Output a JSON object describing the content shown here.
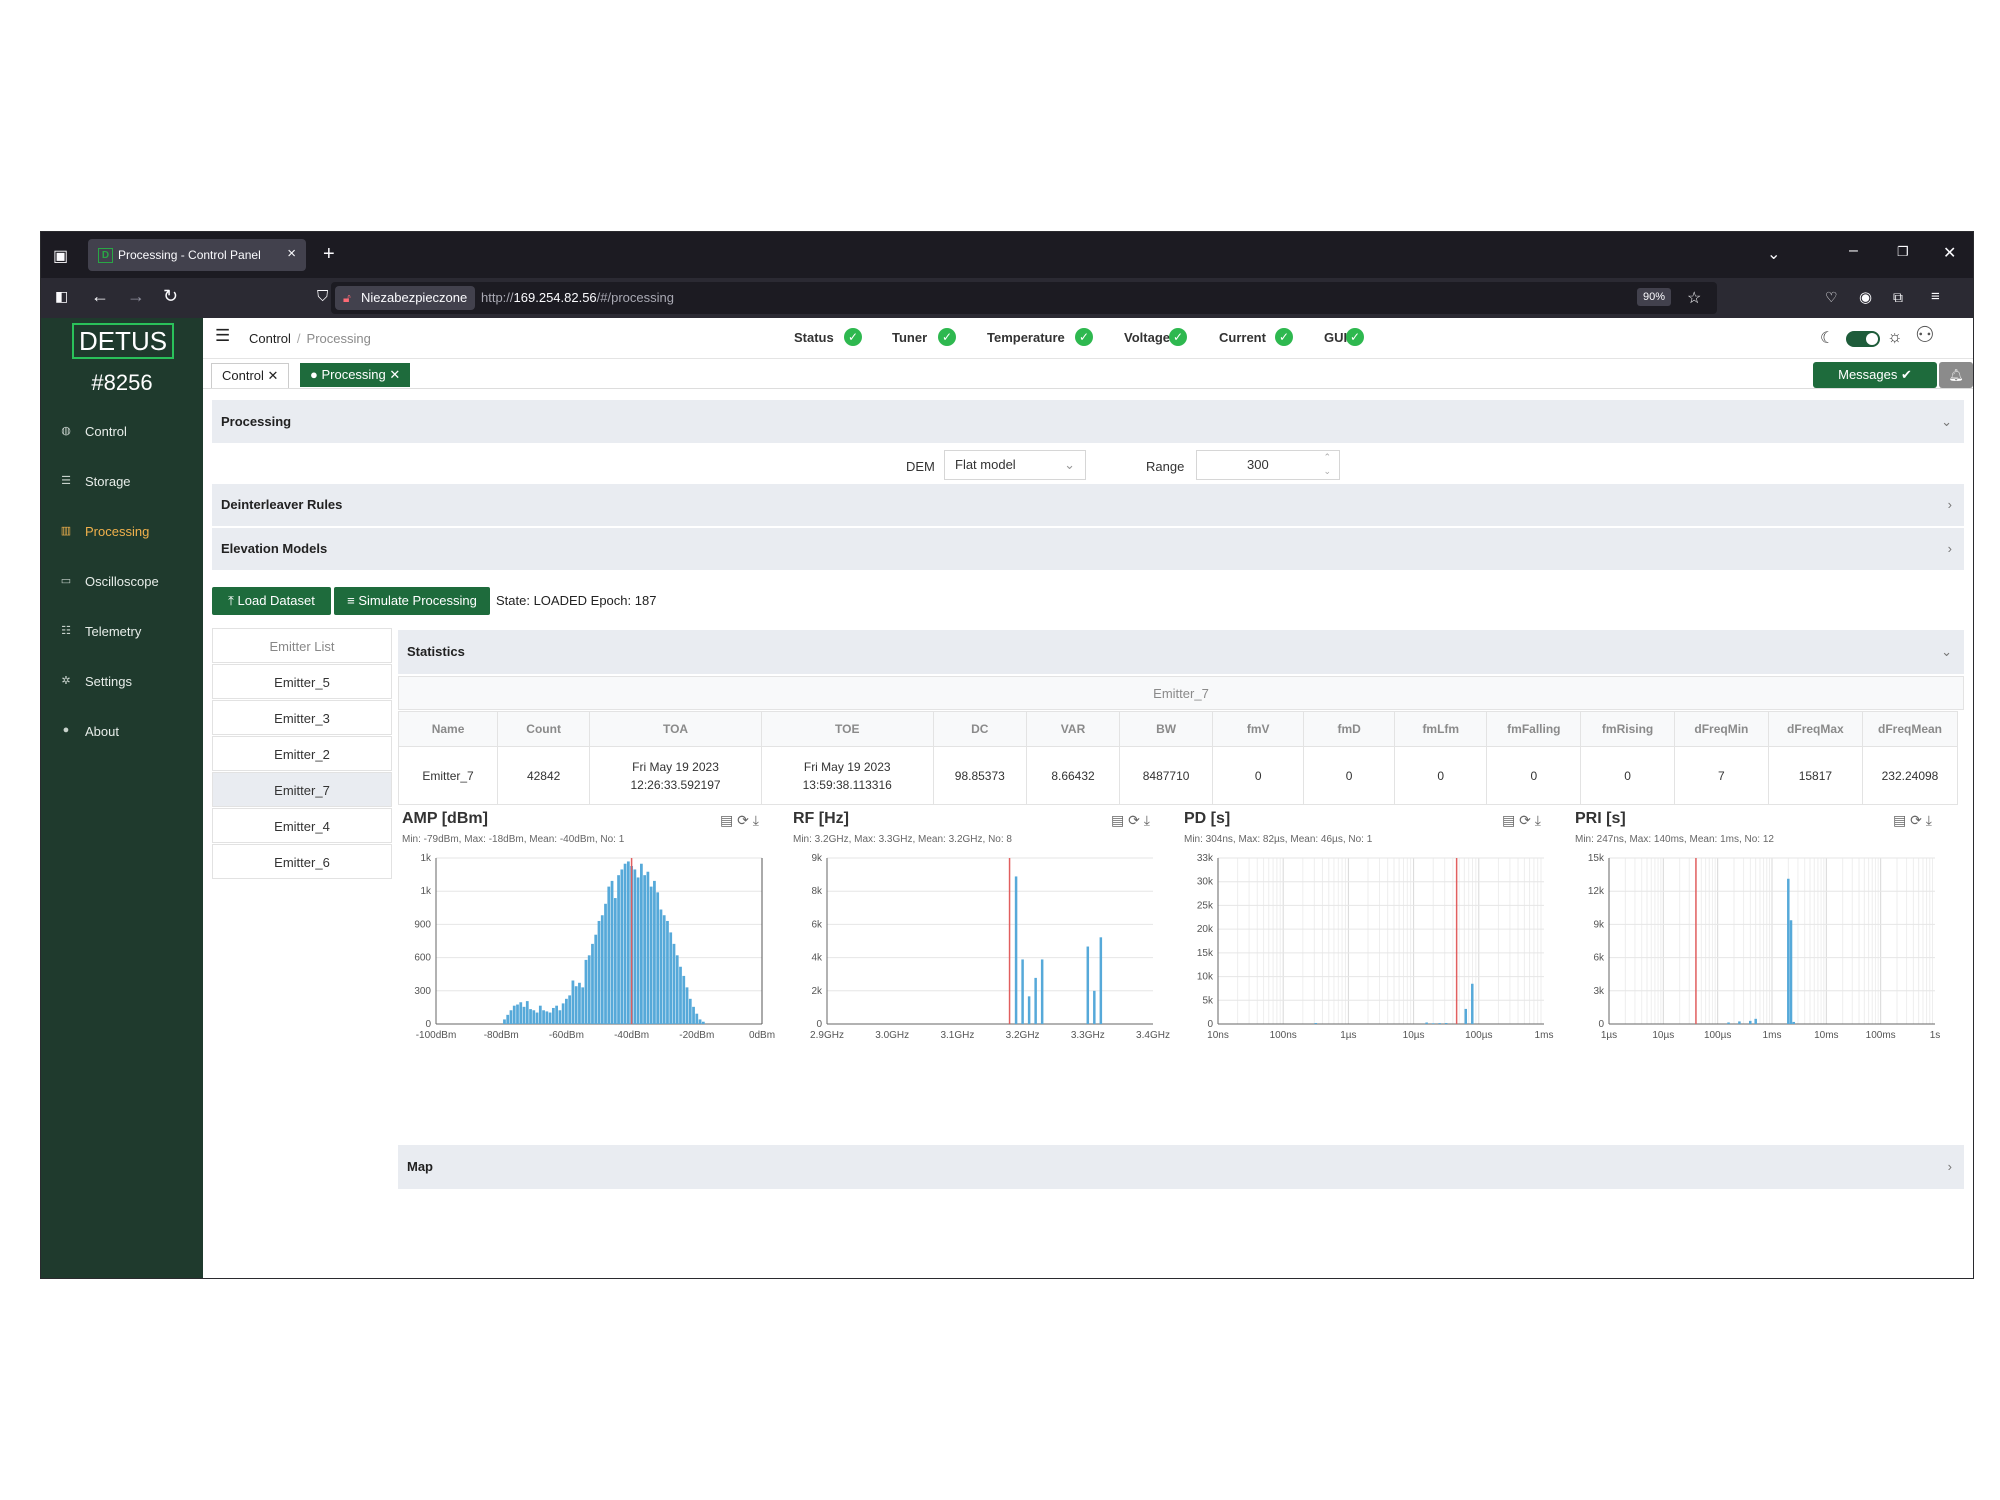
{
  "browser": {
    "tab_title": "Processing - Control Panel",
    "favicon_letter": "D",
    "insecure_label": "Niezabezpieczone",
    "url_prefix": "http://",
    "url_host": "169.254.82.56",
    "url_path": "/#/processing",
    "zoom": "90%"
  },
  "sidebar": {
    "brand": "DETUS",
    "device_id": "#8256",
    "items": [
      {
        "label": "Control",
        "icon": "dashboard-icon"
      },
      {
        "label": "Storage",
        "icon": "database-icon"
      },
      {
        "label": "Processing",
        "icon": "bar-chart-icon",
        "active": true
      },
      {
        "label": "Oscilloscope",
        "icon": "monitor-icon"
      },
      {
        "label": "Telemetry",
        "icon": "list-icon"
      },
      {
        "label": "Settings",
        "icon": "gear-icon"
      },
      {
        "label": "About",
        "icon": "info-icon"
      }
    ]
  },
  "header": {
    "breadcrumb": [
      "Control",
      "Processing"
    ],
    "statuses": [
      "Status",
      "Tuner",
      "Temperature",
      "Voltage",
      "Current",
      "GUI"
    ]
  },
  "page_tabs": {
    "control": "Control ✕",
    "processing": "● Processing ✕",
    "messages": "Messages"
  },
  "processing": {
    "title": "Processing",
    "dem_label": "DEM",
    "dem_value": "Flat model",
    "range_label": "Range",
    "range_value": "300",
    "deinterleaver": "Deinterleaver Rules",
    "elevation": "Elevation Models",
    "load_btn": "⤒ Load Dataset",
    "sim_btn": "≡ Simulate Processing",
    "state": "State: LOADED Epoch: 187"
  },
  "emitter_list": {
    "header": "Emitter List",
    "items": [
      "Emitter_5",
      "Emitter_3",
      "Emitter_2",
      "Emitter_7",
      "Emitter_4",
      "Emitter_6"
    ],
    "selected": "Emitter_7"
  },
  "statistics": {
    "title": "Statistics",
    "emitter": "Emitter_7",
    "columns": [
      "Name",
      "Count",
      "TOA",
      "TOE",
      "DC",
      "VAR",
      "BW",
      "fmV",
      "fmD",
      "fmLfm",
      "fmFalling",
      "fmRising",
      "dFreqMin",
      "dFreqMax",
      "dFreqMean"
    ],
    "row": [
      "Emitter_7",
      "42842",
      "Fri May 19 2023 12:26:33.592197",
      "Fri May 19 2023 13:59:38.113316",
      "98.85373",
      "8.66432",
      "8487710",
      "0",
      "0",
      "0",
      "0",
      "0",
      "7",
      "15817",
      "232.24098"
    ]
  },
  "map": {
    "title": "Map"
  },
  "chart_data": [
    {
      "type": "bar",
      "title": "AMP [dBm]",
      "subtitle": "Min: -79dBm, Max: -18dBm, Mean: -40dBm, No: 1",
      "x_tick_labels": [
        "-100dBm",
        "-80dBm",
        "-60dBm",
        "-40dBm",
        "-20dBm",
        "0dBm"
      ],
      "y_tick_labels": [
        "0",
        "300",
        "600",
        "900",
        "1k",
        "1k"
      ],
      "ylim": [
        0,
        1450
      ],
      "xlim": [
        -100,
        0
      ],
      "bins": [
        -79,
        -78,
        -77,
        -76,
        -75,
        -74,
        -73,
        -72,
        -71,
        -70,
        -69,
        -68,
        -67,
        -66,
        -65,
        -64,
        -63,
        -62,
        -61,
        -60,
        -59,
        -58,
        -57,
        -56,
        -55,
        -54,
        -53,
        -52,
        -51,
        -50,
        -49,
        -48,
        -47,
        -46,
        -45,
        -44,
        -43,
        -42,
        -41,
        -40,
        -39,
        -38,
        -37,
        -36,
        -35,
        -34,
        -33,
        -32,
        -31,
        -30,
        -29,
        -28,
        -27,
        -26,
        -25,
        -24,
        -23,
        -22,
        -21,
        -20,
        -19,
        -18
      ],
      "values": [
        40,
        80,
        120,
        160,
        170,
        190,
        150,
        200,
        130,
        120,
        100,
        160,
        120,
        110,
        100,
        140,
        160,
        120,
        180,
        220,
        250,
        380,
        330,
        360,
        320,
        560,
        600,
        700,
        780,
        900,
        950,
        1050,
        1200,
        1250,
        1100,
        1300,
        1350,
        1400,
        1420,
        1380,
        1350,
        1280,
        1400,
        1300,
        1330,
        1200,
        1250,
        1150,
        1000,
        950,
        900,
        800,
        700,
        600,
        500,
        420,
        320,
        220,
        150,
        90,
        40,
        20
      ],
      "mean": -40,
      "colors": {
        "bar": "#56a9d9",
        "mean": "#e15f5f"
      }
    },
    {
      "type": "bar",
      "title": "RF [Hz]",
      "subtitle": "Min: 3.2GHz, Max: 3.3GHz, Mean: 3.2GHz, No: 8",
      "x_tick_labels": [
        "2.9GHz",
        "3.0GHz",
        "3.1GHz",
        "3.2GHz",
        "3.3GHz",
        "3.4GHz"
      ],
      "y_tick_labels": [
        "0",
        "2k",
        "4k",
        "6k",
        "8k",
        "9k"
      ],
      "ylim": [
        0,
        9000
      ],
      "xlim": [
        2.9,
        3.4
      ],
      "bins": [
        3.19,
        3.2,
        3.21,
        3.22,
        3.23,
        3.3,
        3.31,
        3.32
      ],
      "values": [
        8000,
        3500,
        1500,
        2500,
        3500,
        4200,
        1800,
        4700
      ],
      "mean": 3.18,
      "colors": {
        "bar": "#56a9d9",
        "mean": "#e15f5f"
      }
    },
    {
      "type": "bar",
      "scale": "log",
      "title": "PD [s]",
      "subtitle": "Min: 304ns, Max: 82µs, Mean: 46µs, No: 1",
      "x_tick_labels": [
        "10ns",
        "100ns",
        "1µs",
        "10µs",
        "100µs",
        "1ms"
      ],
      "y_tick_labels": [
        "0",
        "5k",
        "10k",
        "15k",
        "20k",
        "25k",
        "30k",
        "33k"
      ],
      "ylim": [
        0,
        33000
      ],
      "xlim_log10": [
        -8,
        -3
      ],
      "bins_log10": [
        -6.5,
        -4.8,
        -4.7,
        -4.6,
        -4.5,
        -4.2,
        -4.1
      ],
      "values": [
        200,
        300,
        150,
        180,
        200,
        3000,
        8000
      ],
      "mean_log10": -4.34,
      "colors": {
        "bar": "#56a9d9",
        "mean": "#e15f5f"
      }
    },
    {
      "type": "bar",
      "scale": "log",
      "title": "PRI [s]",
      "subtitle": "Min: 247ns, Max: 140ms, Mean: 1ms, No: 12",
      "x_tick_labels": [
        "1µs",
        "10µs",
        "100µs",
        "1ms",
        "10ms",
        "100ms",
        "1s"
      ],
      "y_tick_labels": [
        "0",
        "3k",
        "6k",
        "9k",
        "12k",
        "15k"
      ],
      "ylim": [
        0,
        16000
      ],
      "xlim_log10": [
        -6,
        0
      ],
      "bins_log10": [
        -3.8,
        -3.6,
        -3.4,
        -3.3,
        -2.7,
        -2.65,
        -2.6
      ],
      "values": [
        150,
        250,
        300,
        500,
        14000,
        10000,
        200
      ],
      "mean_log10": -4.4,
      "colors": {
        "bar": "#56a9d9",
        "mean": "#e15f5f"
      }
    }
  ]
}
